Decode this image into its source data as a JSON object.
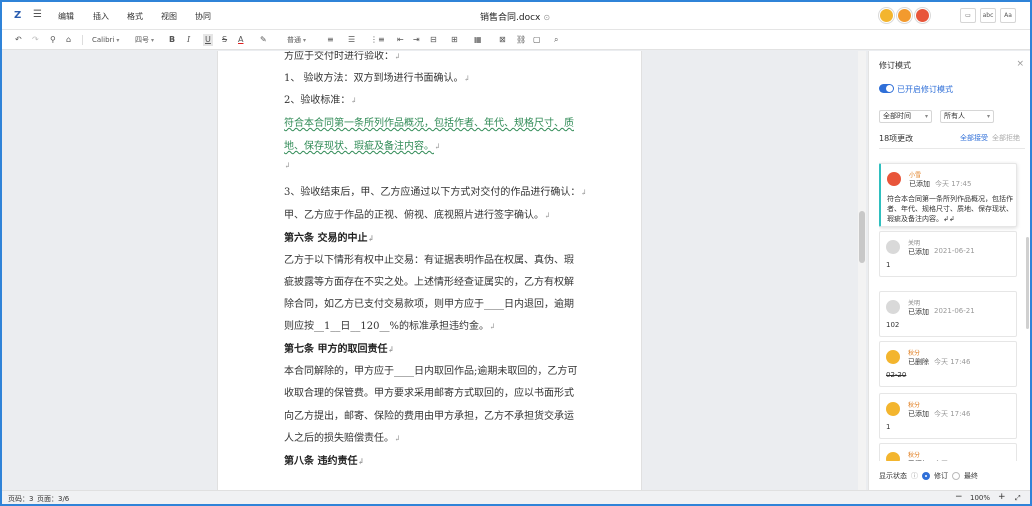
{
  "app": {
    "menus": [
      "编辑",
      "插入",
      "格式",
      "视图",
      "协同"
    ],
    "doc_title": "销售合同.docx",
    "title_status": "⊙",
    "header_buttons": [
      "▭",
      "abc",
      "Aa"
    ]
  },
  "toolbar": {
    "font": "Calibri",
    "size": "四号",
    "style": "普通",
    "icons": [
      "↶",
      "↷",
      "⚲",
      "⌂",
      "B",
      "I",
      "U",
      "S",
      "A",
      "✎",
      "≡",
      "☰",
      "⋮≡",
      "⇤",
      "⇥",
      "⊟",
      "⊞",
      "▦",
      "⊠",
      "⛓",
      "▢",
      "⌕"
    ]
  },
  "document": {
    "lines": [
      {
        "text": "方应于交付时进行验收：",
        "mark": "↲",
        "bold": false
      },
      {
        "text": "1、 验收方法：双方到场进行书面确认。",
        "mark": "↲",
        "bold": false
      },
      {
        "text": "2、验收标准：",
        "mark": "↲",
        "bold": false
      },
      {
        "text": "符合本合同第一条所列作品概况，包括作者、年代、规格尺寸、质",
        "mark": "",
        "bold": false,
        "ins": true
      },
      {
        "text": "地、保存现状、瑕疵及备注内容。",
        "mark": "↲",
        "bold": false,
        "ins": true
      },
      {
        "text": "",
        "mark": "↲",
        "bold": false
      },
      {
        "text": "3、验收结束后，甲、乙方应通过以下方式对交付的作品进行确认：",
        "mark": "↲",
        "bold": false
      },
      {
        "text": "甲、乙方应于作品的正视、俯视、底视照片进行签字确认。",
        "mark": "↲",
        "bold": false
      },
      {
        "text": "第六条 交易的中止",
        "mark": "↲",
        "bold": true
      },
      {
        "text": "乙方于以下情形有权中止交易：有证据表明作品在权属、真伪、瑕",
        "mark": "",
        "bold": false
      },
      {
        "text": "疵披露等方面存在不实之处。上述情形经查证属实的，乙方有权解",
        "mark": "",
        "bold": false
      },
      {
        "text": "除合同，如乙方已支付交易款项，则甲方应于____日内退回，逾期",
        "mark": "",
        "bold": false
      },
      {
        "text": "则应按__1__日__120__%的标准承担违约金。",
        "mark": "↲",
        "bold": false
      },
      {
        "text": "第七条 甲方的取回责任",
        "mark": "↲",
        "bold": true
      },
      {
        "text": "本合同解除的，甲方应于____日内取回作品;逾期未取回的，乙方可",
        "mark": "",
        "bold": false
      },
      {
        "text": "收取合理的保管费。甲方要求采用邮寄方式取回的，应以书面形式",
        "mark": "",
        "bold": false
      },
      {
        "text": "向乙方提出，邮寄、保险的费用由甲方承担，乙方不承担货交承运",
        "mark": "",
        "bold": false
      },
      {
        "text": "人之后的损失赔偿责任。",
        "mark": "↲",
        "bold": false
      },
      {
        "text": "第八条 违约责任",
        "mark": "↲",
        "bold": true
      }
    ]
  },
  "panel": {
    "title": "修订模式",
    "close": "×",
    "toggle_label": "已开启修订模式",
    "filter_time": "全部时间",
    "filter_user": "所有人",
    "count": "18项更改",
    "accept_all": "全部接受",
    "reject_all": "全部拒绝",
    "cards": [
      {
        "name": "小雪",
        "action": "已添加",
        "time": "今天 17:45",
        "body": "符合本合同第一条所列作品概况，包括作者、年代、规格尺寸、质地、保存现状、瑕疵及备注内容。↲↲",
        "avatar_color": "#e8553a",
        "active": true
      },
      {
        "name": "关明",
        "action": "已添加",
        "time": "2021-06-21",
        "body": "1",
        "avatar_color": "#d9d9d9"
      },
      {
        "name": "关明",
        "action": "已添加",
        "time": "2021-06-21",
        "body": "102",
        "avatar_color": "#d9d9d9"
      },
      {
        "name": "秋分",
        "action": "已删除",
        "time": "今天 17:46",
        "body": "02-20",
        "avatar_color": "#f3b52e"
      },
      {
        "name": "秋分",
        "action": "已添加",
        "time": "今天 17:46",
        "body": "1",
        "avatar_color": "#f3b52e"
      },
      {
        "name": "秋分",
        "action": "已添加",
        "time": "今天 17:46",
        "body": "",
        "avatar_color": "#f3b52e"
      }
    ],
    "display_label": "显示状态",
    "opt_revision": "修订",
    "opt_final": "最终"
  },
  "status": {
    "words": "页码：3",
    "pages": "页面：3/6",
    "minus": "−",
    "zoom": "100%",
    "plus": "+",
    "fit": "⤢"
  },
  "colors": {
    "accent": "#2f6fd8",
    "frame": "#2f83d8",
    "avatar_yellow": "#f3b52e",
    "avatar_red": "#e8553a"
  }
}
